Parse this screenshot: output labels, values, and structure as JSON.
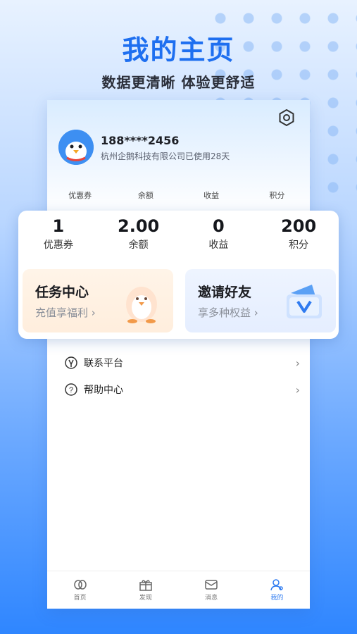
{
  "promo": {
    "title": "我的主页",
    "subtitle": "数据更清晰 体验更舒适"
  },
  "profile": {
    "phone": "188****2456",
    "company": "杭州企鹅科技有限公司已使用28天"
  },
  "small_stats": [
    "优惠券",
    "余额",
    "收益",
    "积分"
  ],
  "stats": [
    {
      "value": "1",
      "label": "优惠券"
    },
    {
      "value": "2.00",
      "label": "余额"
    },
    {
      "value": "0",
      "label": "收益"
    },
    {
      "value": "200",
      "label": "积分"
    }
  ],
  "cards": {
    "task": {
      "title": "任务中心",
      "subtitle": "充值享福利 ›"
    },
    "invite": {
      "title": "邀请好友",
      "subtitle": "享多种权益 ›"
    }
  },
  "menu": [
    {
      "label": "联系平台",
      "icon": "contact-icon"
    },
    {
      "label": "帮助中心",
      "icon": "help-icon"
    }
  ],
  "nav": [
    {
      "label": "首页",
      "icon": "home-icon"
    },
    {
      "label": "发现",
      "icon": "gift-icon"
    },
    {
      "label": "消息",
      "icon": "message-icon"
    },
    {
      "label": "我的",
      "icon": "user-icon",
      "active": true
    }
  ],
  "colors": {
    "accent": "#2f7bf0",
    "title_blue": "#1e6ff0"
  }
}
